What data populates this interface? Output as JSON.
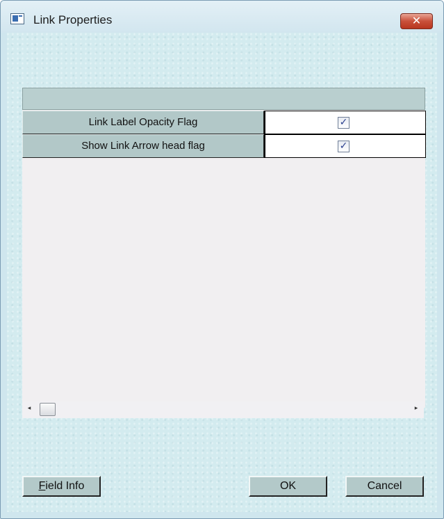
{
  "window": {
    "title": "Link Properties",
    "close_glyph": "✕",
    "icon": "app-window-icon"
  },
  "grid": {
    "header": "",
    "rows": [
      {
        "label": "Link Label Opacity Flag",
        "checked": true,
        "check_glyph": "✓"
      },
      {
        "label": "Show Link Arrow head flag",
        "checked": true,
        "check_glyph": "✓"
      }
    ]
  },
  "scrollbar": {
    "left_arrow": "◂",
    "right_arrow": "▸"
  },
  "buttons": {
    "field_info_mnemonic": "F",
    "field_info_rest": "ield Info",
    "ok": "OK",
    "cancel": "Cancel"
  }
}
